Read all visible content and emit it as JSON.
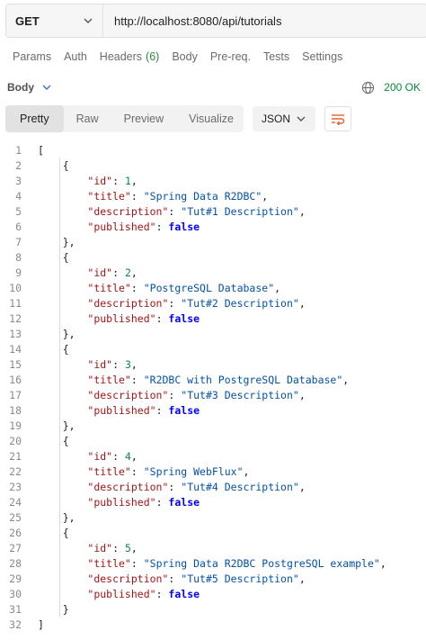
{
  "request": {
    "method": "GET",
    "url": "http://localhost:8080/api/tutorials"
  },
  "tabs": [
    {
      "label": "Params"
    },
    {
      "label": "Auth"
    },
    {
      "label": "Headers",
      "count": "(6)"
    },
    {
      "label": "Body"
    },
    {
      "label": "Pre-req."
    },
    {
      "label": "Tests"
    },
    {
      "label": "Settings"
    }
  ],
  "response": {
    "section_label": "Body",
    "status": "200 OK",
    "view_options": [
      "Pretty",
      "Raw",
      "Preview",
      "Visualize"
    ],
    "active_view": "Pretty",
    "format": "JSON"
  },
  "tutorials": [
    {
      "id": 1,
      "title": "Spring Data R2DBC",
      "description": "Tut#1 Description",
      "published": "false"
    },
    {
      "id": 2,
      "title": "PostgreSQL Database",
      "description": "Tut#2 Description",
      "published": "false"
    },
    {
      "id": 3,
      "title": "R2DBC with PostgreSQL Database",
      "description": "Tut#3 Description",
      "published": "false"
    },
    {
      "id": 4,
      "title": "Spring WebFlux",
      "description": "Tut#4 Description",
      "published": "false"
    },
    {
      "id": 5,
      "title": "Spring Data R2DBC PostgreSQL example",
      "description": "Tut#5 Description",
      "published": "false"
    }
  ],
  "colors": {
    "key": "#a31515",
    "string": "#0451a5",
    "number": "#098658",
    "boolean": "#0000ff",
    "status_ok": "#0a8a3a",
    "wrap_icon": "#e8612c"
  }
}
